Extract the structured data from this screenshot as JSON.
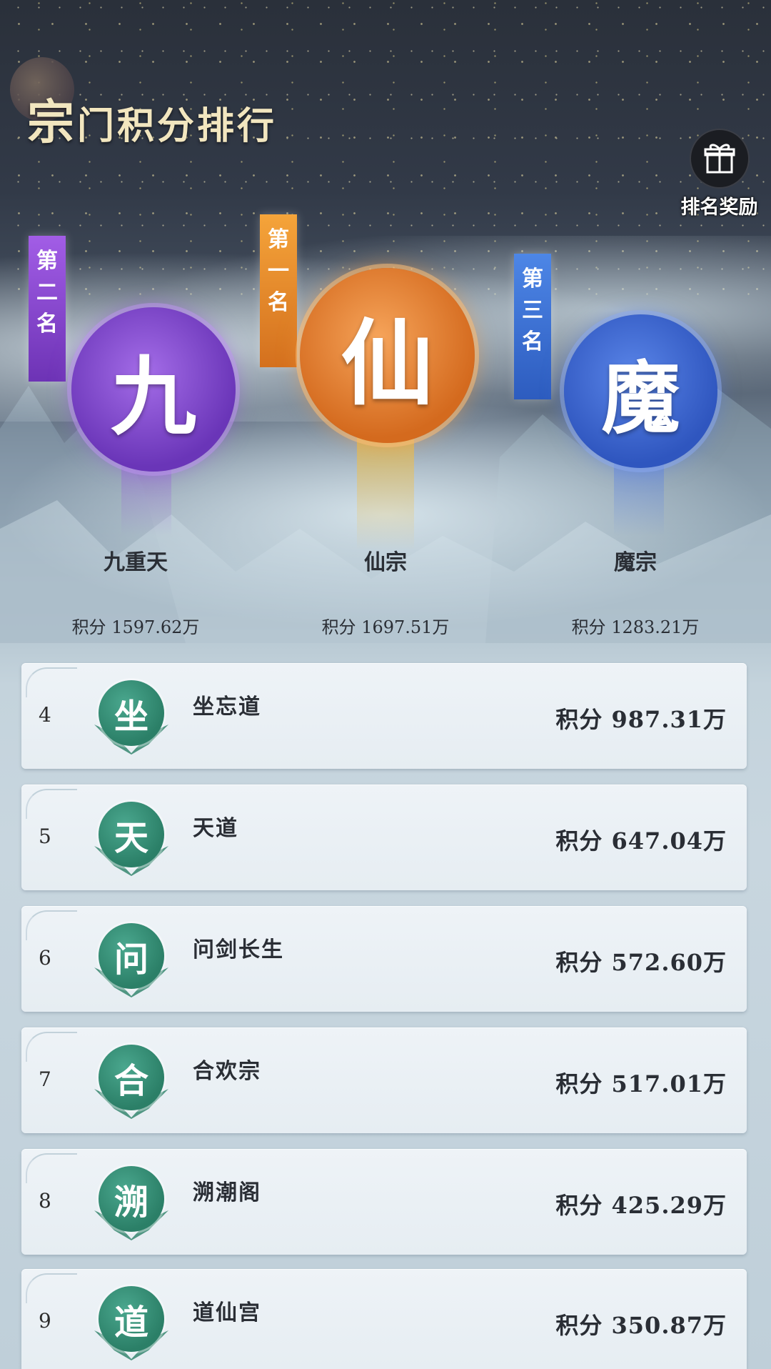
{
  "header": {
    "title_first": "宗",
    "title_rest": "门积分排行",
    "reward_label": "排名奖励"
  },
  "podium": [
    {
      "place_label": "第二名",
      "glyph": "九",
      "name": "九重天",
      "score": "积分 1597.62万",
      "color": "#8a4fd0"
    },
    {
      "place_label": "第一名",
      "glyph": "仙",
      "name": "仙宗",
      "score": "积分 1697.51万",
      "color": "#e07a2a"
    },
    {
      "place_label": "第三名",
      "glyph": "魔",
      "name": "魔宗",
      "score": "积分 1283.21万",
      "color": "#3e62c8"
    }
  ],
  "list": [
    {
      "rank": "4",
      "glyph": "坐",
      "name": "坐忘道",
      "score": "积分 987.31万"
    },
    {
      "rank": "5",
      "glyph": "天",
      "name": "天道",
      "score": "积分 647.04万"
    },
    {
      "rank": "6",
      "glyph": "问",
      "name": "问剑长生",
      "score": "积分 572.60万"
    },
    {
      "rank": "7",
      "glyph": "合",
      "name": "合欢宗",
      "score": "积分 517.01万"
    },
    {
      "rank": "8",
      "glyph": "溯",
      "name": "溯潮阁",
      "score": "积分 425.29万"
    },
    {
      "rank": "9",
      "glyph": "道",
      "name": "道仙宫",
      "score": "积分 350.87万"
    }
  ],
  "colors": {
    "badge_green": "#2b7f67",
    "title_gold": "#f2e6bf"
  },
  "icons": {
    "reward": "gift-icon"
  }
}
